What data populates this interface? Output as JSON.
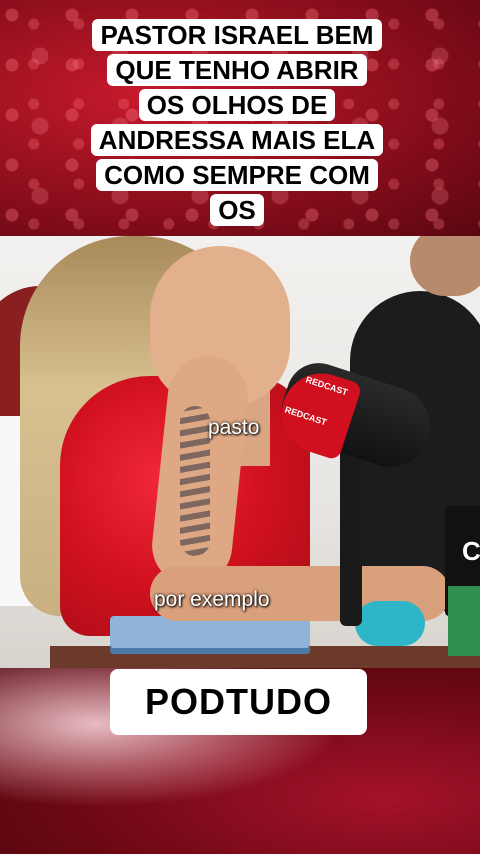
{
  "caption_top": {
    "lines": [
      "PASTOR ISRAEL BEM",
      "QUE TENHO ABRIR",
      "OS OLHOS DE",
      "ANDRESSA MAIS ELA",
      "COMO SEMPRE COM",
      "OS"
    ]
  },
  "video": {
    "subtitles": [
      "pasto",
      "por exemplo"
    ],
    "mic_brand": [
      "REDCAST",
      "REDCAST"
    ],
    "laptop_glyph": "C"
  },
  "caption_bottom": {
    "text": "PODTUDO"
  },
  "colors": {
    "background_red": "#8c0e1c",
    "caption_bg": "#ffffff",
    "caption_text": "#000000",
    "subtitle_text": "#ffffff"
  }
}
